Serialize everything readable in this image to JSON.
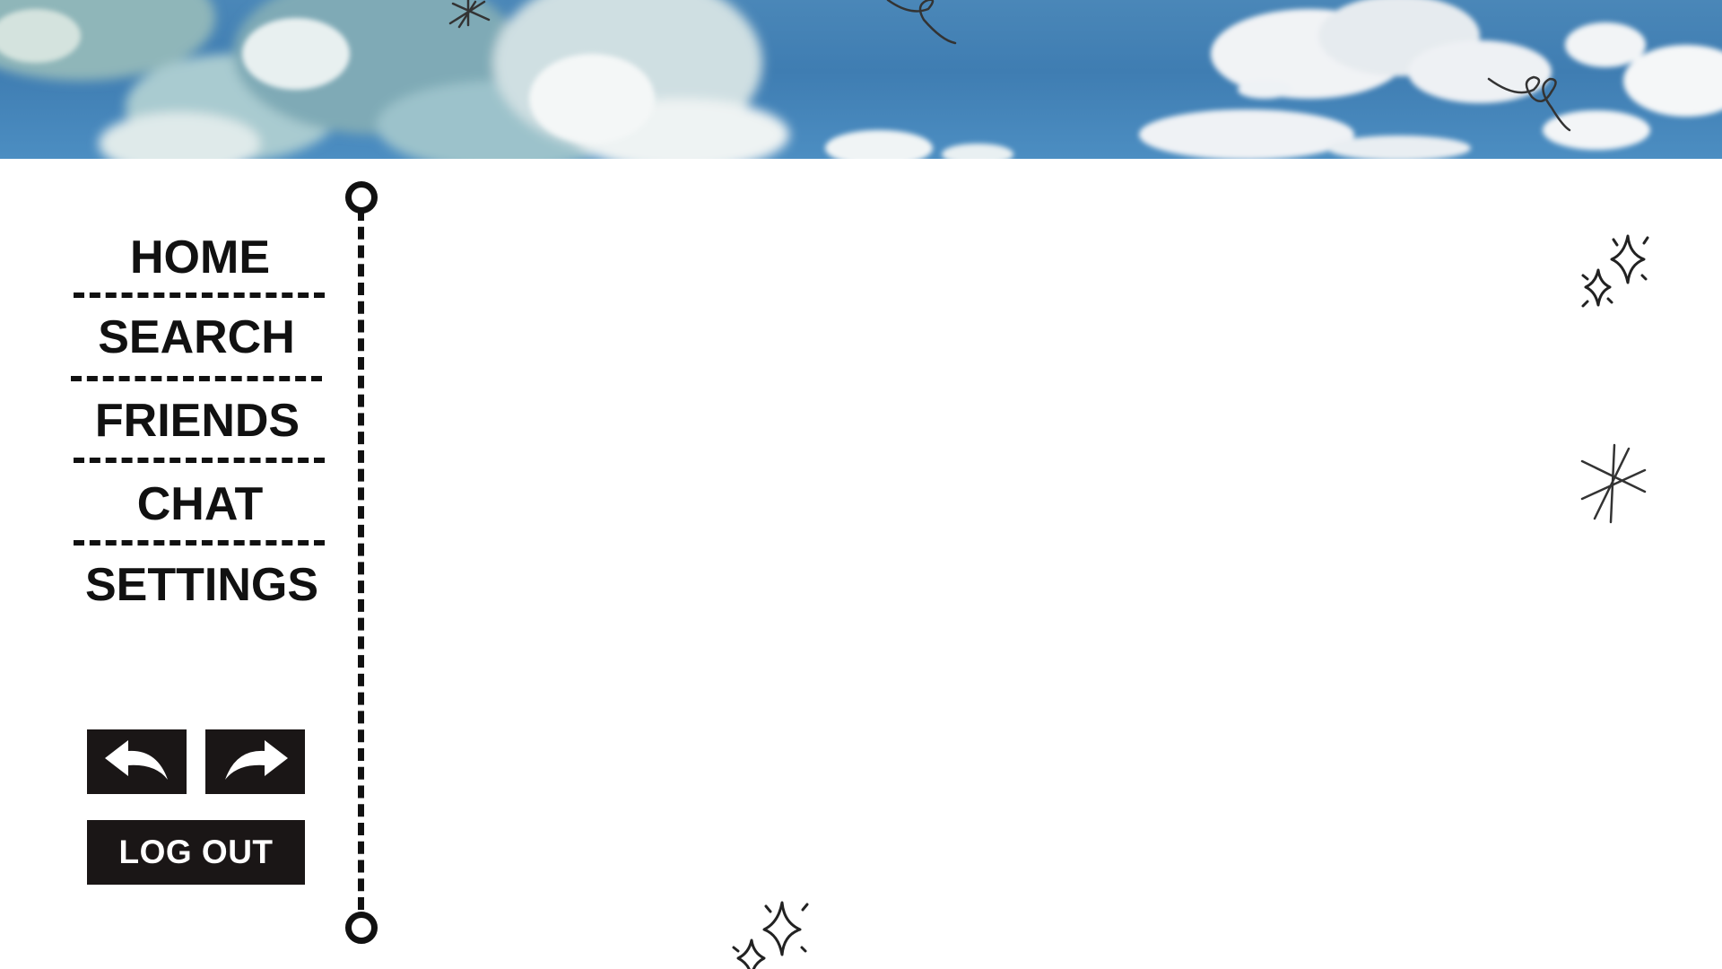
{
  "nav": {
    "items": [
      {
        "label": "HOME"
      },
      {
        "label": "SEARCH"
      },
      {
        "label": "FRIENDS"
      },
      {
        "label": "CHAT"
      },
      {
        "label": "SETTINGS"
      }
    ]
  },
  "controls": {
    "back_icon": "back-arrow-icon",
    "forward_icon": "forward-arrow-icon",
    "logout_label": "LOG OUT"
  },
  "theme": {
    "sky_color": "#4a87b8",
    "ink_color": "#111111",
    "button_color": "#1a1616",
    "background": "#ffffff"
  }
}
